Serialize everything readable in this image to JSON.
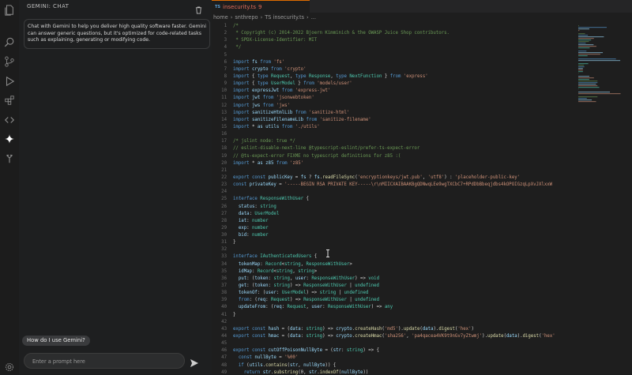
{
  "chat": {
    "title": "GEMINI: CHAT",
    "message": "Chat with Gemini to help you deliver high quality software faster. Gemini can answer generic questions, but it's optimized for code-related tasks such as explaining, generating or modifying code.",
    "suggestion": "How do I use Gemini?",
    "prompt_placeholder": "Enter a prompt here"
  },
  "editor": {
    "tab": {
      "badge": "TS",
      "name": "insecurity.ts",
      "problems": "9"
    },
    "breadcrumb": [
      "home",
      "›",
      "snthrepo",
      "›",
      "TS insecurity.ts",
      "›",
      "..."
    ]
  },
  "code_lines": [
    {
      "n": "1",
      "t": "/*"
    },
    {
      "n": "2",
      "t": " * Copyright (c) 2014-2022 Bjoern Kimminich & the OWASP Juice Shop contributors."
    },
    {
      "n": "3",
      "t": " * SPDX-License-Identifier: MIT"
    },
    {
      "n": "4",
      "t": " */"
    },
    {
      "n": "5",
      "t": ""
    },
    {
      "n": "6",
      "t": "import fs from 'fs'"
    },
    {
      "n": "7",
      "t": "import crypto from 'crypto'"
    },
    {
      "n": "8",
      "t": "import { type Request, type Response, type NextFunction } from 'express'"
    },
    {
      "n": "9",
      "t": "import { type UserModel } from 'models/user'"
    },
    {
      "n": "10",
      "t": "import expressJwt from 'express-jwt'"
    },
    {
      "n": "11",
      "t": "import jwt from 'jsonwebtoken'"
    },
    {
      "n": "12",
      "t": "import jws from 'jws'"
    },
    {
      "n": "13",
      "t": "import sanitizeHtmlLib from 'sanitize-html'"
    },
    {
      "n": "14",
      "t": "import sanitizeFilenameLib from 'sanitize-filename'"
    },
    {
      "n": "15",
      "t": "import * as utils from './utils'"
    },
    {
      "n": "16",
      "t": ""
    },
    {
      "n": "17",
      "t": "/* jslint node: true */"
    },
    {
      "n": "18",
      "t": "// eslint-disable-next-line @typescript-eslint/prefer-ts-expect-error"
    },
    {
      "n": "19",
      "t": "// @ts-expect-error FIXME no typescript definitions for z85 :("
    },
    {
      "n": "20",
      "t": "import * as z85 from 'z85'"
    },
    {
      "n": "21",
      "t": ""
    },
    {
      "n": "22",
      "t": "export const publicKey = fs ? fs.readFileSync('encryptionkeys/jwt.pub', 'utf8') : 'placeholder-public-key'"
    },
    {
      "n": "23",
      "t": "const privateKey = '-----BEGIN RSA PRIVATE KEY-----\\r\\nMIICXAIBAAKBgQDNwqLEe9wgTXCbC7+RPdDbBbeqjdbs4kOPOIGzqLpXvJXlxxW"
    },
    {
      "n": "24",
      "t": ""
    },
    {
      "n": "25",
      "t": "interface ResponseWithUser {"
    },
    {
      "n": "26",
      "t": "  status: string"
    },
    {
      "n": "27",
      "t": "  data: UserModel"
    },
    {
      "n": "28",
      "t": "  iat: number"
    },
    {
      "n": "29",
      "t": "  exp: number"
    },
    {
      "n": "30",
      "t": "  bid: number"
    },
    {
      "n": "31",
      "t": "}"
    },
    {
      "n": "32",
      "t": ""
    },
    {
      "n": "33",
      "t": "interface IAuthenticatedUsers {"
    },
    {
      "n": "34",
      "t": "  tokenMap: Record<string, ResponseWithUser>"
    },
    {
      "n": "35",
      "t": "  idMap: Record<string, string>"
    },
    {
      "n": "36",
      "t": "  put: (token: string, user: ResponseWithUser) => void"
    },
    {
      "n": "37",
      "t": "  get: (token: string) => ResponseWithUser | undefined"
    },
    {
      "n": "38",
      "t": "  tokenOf: (user: UserModel) => string | undefined"
    },
    {
      "n": "39",
      "t": "  from: (req: Request) => ResponseWithUser | undefined"
    },
    {
      "n": "40",
      "t": "  updateFrom: (req: Request, user: ResponseWithUser) => any"
    },
    {
      "n": "41",
      "t": "}"
    },
    {
      "n": "42",
      "t": ""
    },
    {
      "n": "43",
      "t": "export const hash = (data: string) => crypto.createHash('md5').update(data).digest('hex')"
    },
    {
      "n": "44",
      "t": "export const hmac = (data: string) => crypto.createHmac('sha256', 'pa4qacea4VK9t9nGv7yZtwmj').update(data).digest('hex'"
    },
    {
      "n": "45",
      "t": ""
    },
    {
      "n": "46",
      "t": "export const cutOffPoisonNullByte = (str: string) => {"
    },
    {
      "n": "47",
      "t": "  const nullByte = '%00'"
    },
    {
      "n": "48",
      "t": "  if (utils.contains(str, nullByte)) {"
    },
    {
      "n": "49",
      "t": "    return str.substring(0, str.indexOf(nullByte))"
    }
  ],
  "colors": {
    "comment": "#6a9955",
    "keyword": "#569cd6",
    "string": "#ce9178",
    "type": "#4ec9b0",
    "func": "#dcdcaa",
    "ident": "#9cdcfe",
    "accent": "#e06c00"
  },
  "activity_icons": [
    "files-icon",
    "search-icon",
    "source-control-icon",
    "run-debug-icon",
    "extensions-icon",
    "remote-icon",
    "gemini-icon",
    "tree-icon",
    "settings-icon"
  ]
}
